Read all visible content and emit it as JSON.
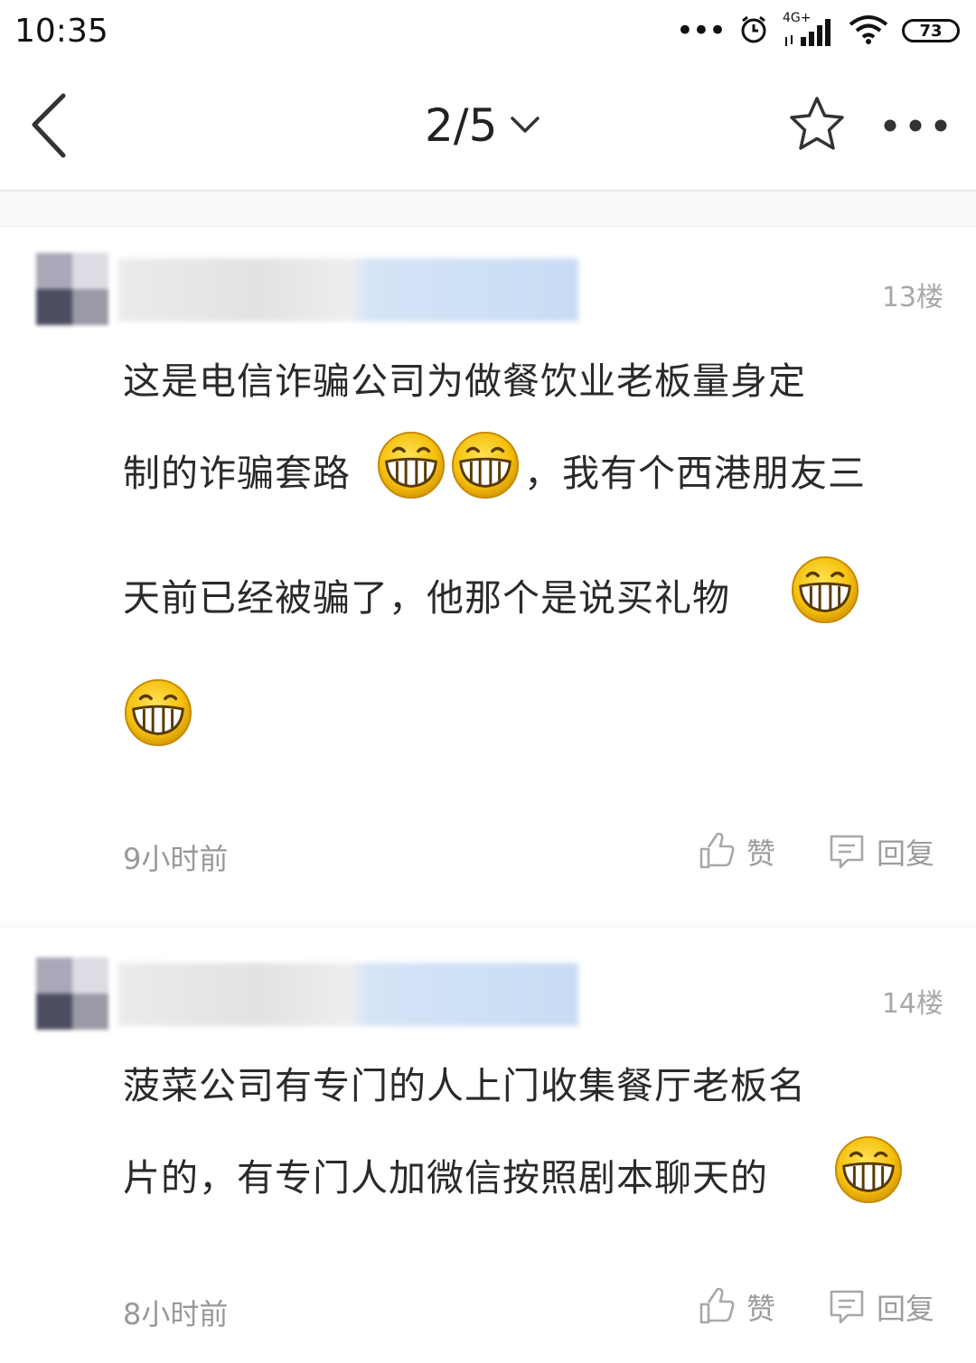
{
  "status_bar": {
    "time": "10:35",
    "dots": "•••",
    "network_label": "4G+",
    "battery_level": "73"
  },
  "nav": {
    "page_indicator": "2/5"
  },
  "comments": [
    {
      "floor": "13楼",
      "line1": "这是电信诈骗公司为做餐饮业老板量身定",
      "line2a": "制的诈骗套路",
      "line2b": "，我有个西港朋友三",
      "line3": "天前已经被骗了，他那个是说买礼物",
      "time": "9小时前",
      "like_label": "赞",
      "reply_label": "回复"
    },
    {
      "floor": "14楼",
      "line1": "菠菜公司有专门的人上门收集餐厅老板名",
      "line2": "片的，有专门人加微信按照剧本聊天的",
      "time": "8小时前",
      "like_label": "赞",
      "reply_label": "回复"
    }
  ],
  "icons": {
    "back": "chevron-left-icon",
    "dropdown": "chevron-down-icon",
    "favorite": "star-icon",
    "more": "more-icon",
    "like": "thumbs-up-icon",
    "reply": "comment-icon",
    "emoji": "grin-emoji-icon"
  },
  "colors": {
    "meta_text": "#999999",
    "emoji_yellow": "#f7c515"
  }
}
